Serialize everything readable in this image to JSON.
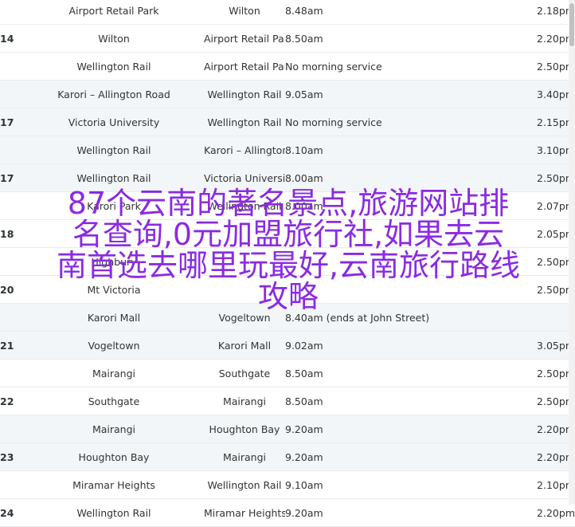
{
  "timetable": {
    "rows": [
      {
        "route": "",
        "from": "Airport Retail Park",
        "to": "Wilton",
        "dep": "8.48am",
        "ret": "2.18pm",
        "shade": false
      },
      {
        "route": "14",
        "from": "Wilton",
        "to": "Airport Retail Park",
        "dep": "8.50am",
        "ret": "2.20pm",
        "shade": false
      },
      {
        "route": "",
        "from": "Wellington Rail",
        "to": "Airport Retail Park",
        "dep": "No morning service",
        "ret": "2.50pm",
        "shade": false
      },
      {
        "route": "",
        "from": "Karori – Allington Road",
        "to": "Wellington Rail",
        "dep": "9.05am",
        "ret": "3.40pm",
        "shade": true
      },
      {
        "route": "17",
        "from": "Victoria University",
        "to": "Wellington Rail",
        "dep": "No morning service",
        "ret": "2.15pm",
        "shade": true
      },
      {
        "route": "",
        "from": "Wellington Rail",
        "to": "Karori – Allington Road",
        "dep": "8.10am",
        "ret": "3.10pm",
        "shade": true
      },
      {
        "route": "17",
        "from": "Wellington Rail",
        "to": "Victoria University",
        "dep": "8.00am",
        "ret": "2.50pm",
        "shade": true
      },
      {
        "route": "",
        "from": "Karori Park",
        "to": "Wellington Rail",
        "dep": "8.00am",
        "ret": "2.07pm",
        "shade": false
      },
      {
        "route": "18",
        "from": "",
        "to": "",
        "dep": "",
        "ret": "2.05pm",
        "shade": false
      },
      {
        "route": "",
        "from": "Highbury",
        "to": "",
        "dep": "",
        "ret": "2.50pm",
        "shade": false
      },
      {
        "route": "20",
        "from": "Mt Victoria",
        "to": "",
        "dep": "",
        "ret": "2.50pm",
        "shade": false
      },
      {
        "route": "",
        "from": "Karori Mall",
        "to": "Vogeltown",
        "dep": "8.40am (ends at John Street)",
        "ret": "",
        "shade": true
      },
      {
        "route": "21",
        "from": "Vogeltown",
        "to": "Karori Mall",
        "dep": "9.02am",
        "ret": "3.05pm",
        "shade": true
      },
      {
        "route": "",
        "from": "Mairangi",
        "to": "Southgate",
        "dep": "8.50am",
        "ret": "2.50pm",
        "shade": false
      },
      {
        "route": "22",
        "from": "Southgate",
        "to": "Mairangi",
        "dep": "8.50am",
        "ret": "2.50pm",
        "shade": false
      },
      {
        "route": "",
        "from": "Mairangi",
        "to": "Houghton Bay",
        "dep": "9.20am",
        "ret": "2.20pm",
        "shade": true
      },
      {
        "route": "23",
        "from": "Houghton Bay",
        "to": "Mairangi",
        "dep": "9.20am",
        "ret": "2.20pm",
        "shade": true
      },
      {
        "route": "",
        "from": "Miramar Heights",
        "to": "Wellington Rail",
        "dep": "9.10am",
        "ret": "2.10pm",
        "shade": false
      },
      {
        "route": "24",
        "from": "Wellington Rail",
        "to": "Miramar Heights",
        "dep": "9.20am",
        "ret": "2.20pm",
        "shade": false
      }
    ]
  },
  "overlay": {
    "line1": "87个云南的著名景点,旅游网站排",
    "line2": "名查询,0元加盟旅行社,如果去云",
    "line3": "南首选去哪里玩最好,云南旅行路线",
    "line4": "攻略",
    "color": "#8a2be2"
  }
}
